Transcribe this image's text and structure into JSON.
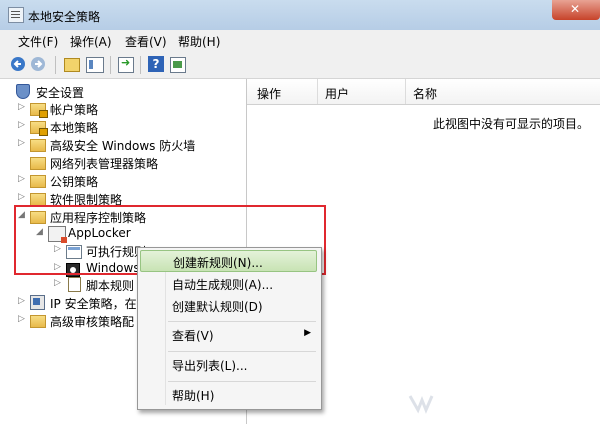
{
  "window": {
    "title": "本地安全策略"
  },
  "menu": [
    "文件(F)",
    "操作(A)",
    "查看(V)",
    "帮助(H)"
  ],
  "tree": [
    {
      "label": "安全设置",
      "icon": "security-settings-icon",
      "expander": ""
    },
    {
      "label": "帐户策略",
      "icon": "folder-icon",
      "expander": "▷"
    },
    {
      "label": "本地策略",
      "icon": "folder-icon",
      "expander": "▷"
    },
    {
      "label": "高级安全 Windows 防火墙",
      "icon": "folder-icon",
      "expander": "▷"
    },
    {
      "label": "网络列表管理器策略",
      "icon": "folder-icon",
      "expander": ""
    },
    {
      "label": "公钥策略",
      "icon": "folder-icon",
      "expander": "▷"
    },
    {
      "label": "软件限制策略",
      "icon": "folder-icon",
      "expander": "▷"
    },
    {
      "label": "应用程序控制策略",
      "icon": "folder-icon",
      "expander": "◢"
    },
    {
      "label": "AppLocker",
      "icon": "applocker-icon",
      "expander": "◢"
    },
    {
      "label": "可执行规则",
      "icon": "executable-rules-icon",
      "expander": "▷"
    },
    {
      "label": "Windows",
      "icon": "windows-installer-icon",
      "expander": "▷"
    },
    {
      "label": "脚本规则",
      "icon": "script-rules-icon",
      "expander": "▷"
    },
    {
      "label": "IP 安全策略，在",
      "icon": "ip-security-icon",
      "expander": "▷"
    },
    {
      "label": "高级审核策略配",
      "icon": "folder-icon",
      "expander": "▷"
    }
  ],
  "list": {
    "columns": [
      "操作",
      "用户",
      "名称"
    ],
    "empty_message": "此视图中没有可显示的项目。"
  },
  "context_menu": {
    "items": [
      {
        "label": "创建新规则(N)...",
        "selected": true
      },
      {
        "label": "自动生成规则(A)..."
      },
      {
        "label": "创建默认规则(D)"
      },
      {
        "label": "查看(V)",
        "submenu": true
      },
      {
        "label": "导出列表(L)..."
      },
      {
        "label": "帮助(H)"
      }
    ]
  },
  "colors": {
    "highlight_border": "#e0282f",
    "menu_selection": "#c8e3b4",
    "titlebar": "#b6cde6"
  }
}
